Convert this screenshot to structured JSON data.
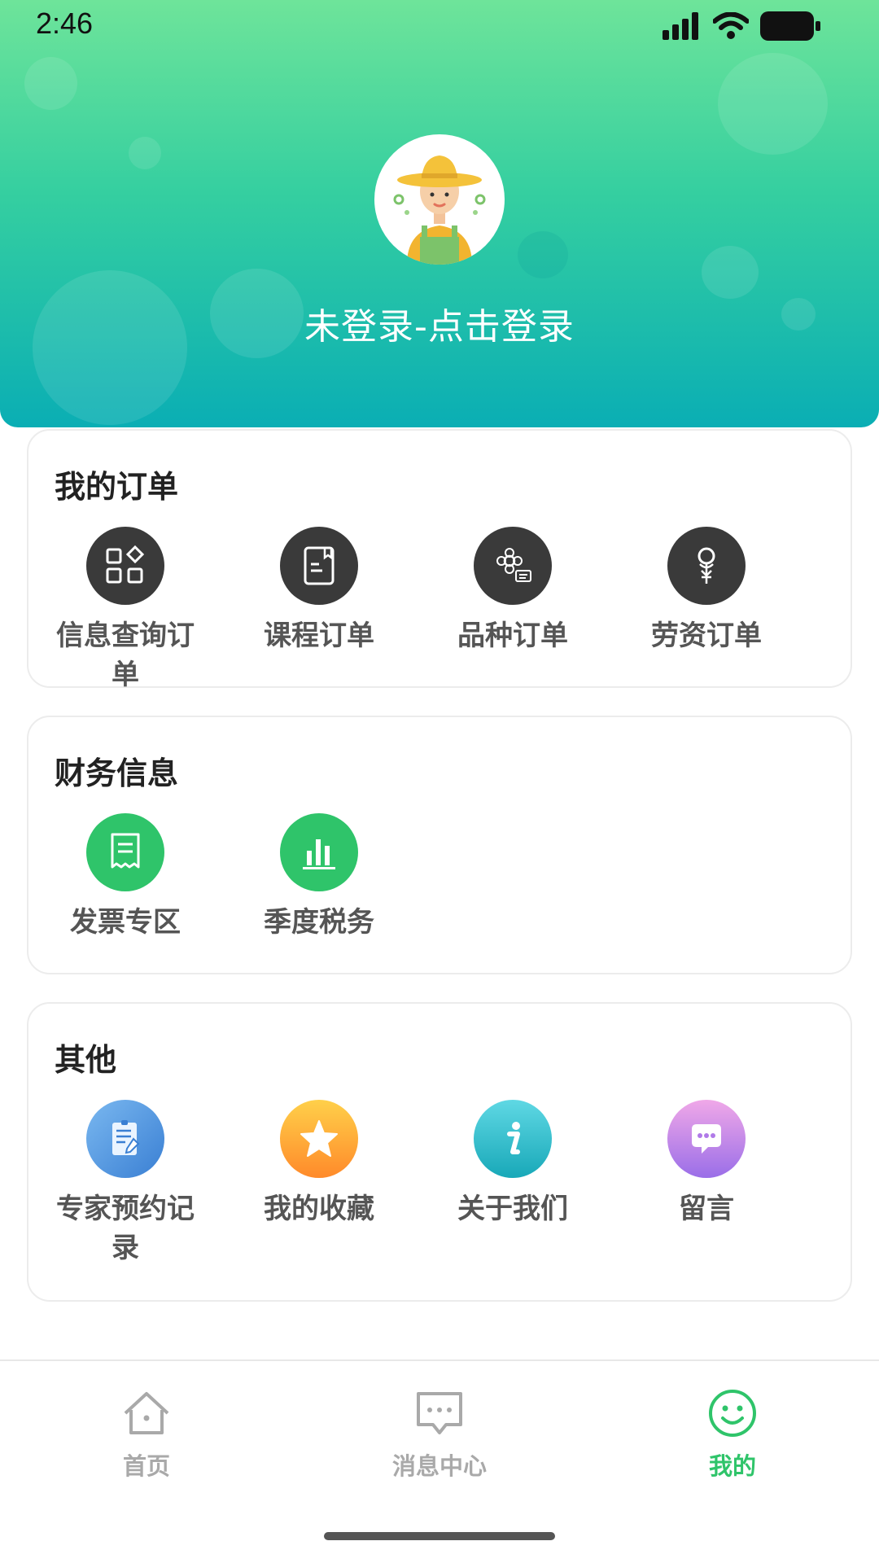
{
  "status": {
    "time": "2:46"
  },
  "profile": {
    "login_text": "未登录-点击登录"
  },
  "orders": {
    "title": "我的订单",
    "items": [
      {
        "label": "信息查询订单",
        "icon": "grid-icon"
      },
      {
        "label": "课程订单",
        "icon": "book-icon"
      },
      {
        "label": "品种订单",
        "icon": "seed-icon"
      },
      {
        "label": "劳资订单",
        "icon": "wage-icon"
      }
    ]
  },
  "finance": {
    "title": "财务信息",
    "items": [
      {
        "label": "发票专区",
        "icon": "receipt-icon"
      },
      {
        "label": "季度税务",
        "icon": "bar-chart-icon"
      }
    ]
  },
  "other": {
    "title": "其他",
    "items": [
      {
        "label": "专家预约记录",
        "icon": "notepad-icon"
      },
      {
        "label": "我的收藏",
        "icon": "star-icon"
      },
      {
        "label": "关于我们",
        "icon": "info-icon"
      },
      {
        "label": "留言",
        "icon": "chat-bubble-icon"
      }
    ]
  },
  "tabbar": {
    "tabs": [
      {
        "label": "首页",
        "icon": "home-icon"
      },
      {
        "label": "消息中心",
        "icon": "message-icon"
      },
      {
        "label": "我的",
        "icon": "smiley-icon"
      }
    ]
  },
  "colors": {
    "header_top": "#6ee49a",
    "header_bottom": "#0aaeb4",
    "accent": "#2fc46a",
    "dark_icon": "#3a3a3a"
  }
}
